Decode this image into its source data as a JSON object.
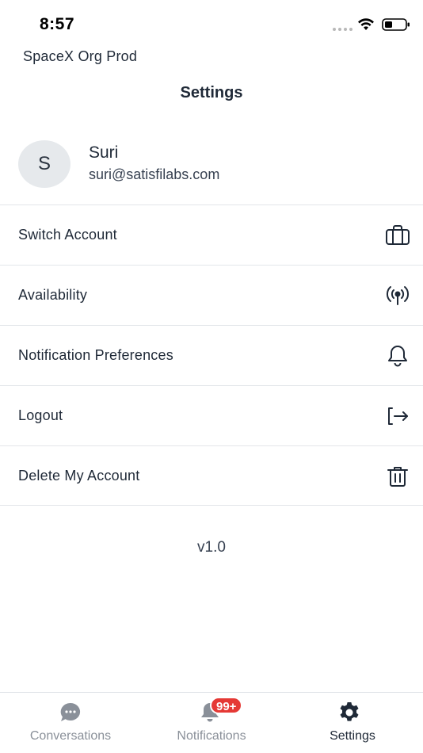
{
  "status_bar": {
    "time": "8:57"
  },
  "header": {
    "org_name": "SpaceX Org Prod",
    "title": "Settings"
  },
  "profile": {
    "avatar_initial": "S",
    "name": "Suri",
    "email": "suri@satisfilabs.com"
  },
  "menu": {
    "items": [
      {
        "label": "Switch Account",
        "icon": "briefcase-icon"
      },
      {
        "label": "Availability",
        "icon": "broadcast-icon"
      },
      {
        "label": "Notification Preferences",
        "icon": "bell-icon"
      },
      {
        "label": "Logout",
        "icon": "logout-icon"
      },
      {
        "label": "Delete My Account",
        "icon": "trash-icon"
      }
    ]
  },
  "version": "v1.0",
  "tab_bar": {
    "tabs": [
      {
        "label": "Conversations",
        "icon": "chat-icon",
        "active": false
      },
      {
        "label": "Notifications",
        "icon": "bell-icon",
        "active": false,
        "badge": "99+"
      },
      {
        "label": "Settings",
        "icon": "gear-icon",
        "active": true
      }
    ]
  },
  "colors": {
    "text": "#1f2937",
    "muted": "#8a9099",
    "badge": "#e53935",
    "avatar_bg": "#e6e9ec",
    "divider": "#e3e6ea"
  }
}
